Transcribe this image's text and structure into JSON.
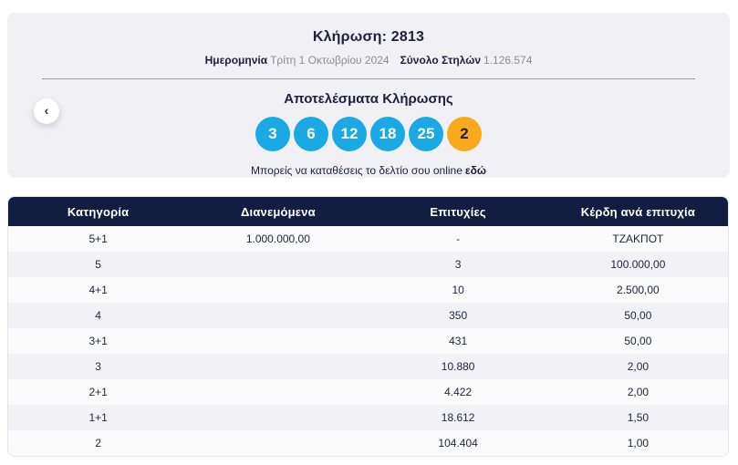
{
  "colors": {
    "ball_blue": "#1ba9e3",
    "ball_orange": "#f9a91c",
    "header_navy": "#131c41",
    "card_bg": "#f1f1f5",
    "row_alt": "#f2f2f6"
  },
  "draw_panel": {
    "title": "Κλήρωση: 2813",
    "date_label": "Ημερομηνία",
    "date_value": "Τρίτη 1 Οκτωβρίου 2024",
    "columns_label": "Σύνολο Στηλών",
    "columns_value": "1.126.574",
    "results_title": "Αποτελέσματα Κλήρωσης",
    "numbers": [
      "3",
      "6",
      "12",
      "18",
      "25"
    ],
    "joker_number": "2",
    "online_text": "Μπορείς να καταθέσεις το δελτίο σου online",
    "online_link_label": "εδώ",
    "prev_button_icon": "‹"
  },
  "prize_table": {
    "headers": [
      "Κατηγορία",
      "Διανεμόμενα",
      "Επιτυχίες",
      "Κέρδη ανά επιτυχία"
    ],
    "rows": [
      {
        "category": "5+1",
        "distributed": "1.000.000,00",
        "wins": "-",
        "prize": "ΤΖΑΚΠΟΤ"
      },
      {
        "category": "5",
        "distributed": "",
        "wins": "3",
        "prize": "100.000,00"
      },
      {
        "category": "4+1",
        "distributed": "",
        "wins": "10",
        "prize": "2.500,00"
      },
      {
        "category": "4",
        "distributed": "",
        "wins": "350",
        "prize": "50,00"
      },
      {
        "category": "3+1",
        "distributed": "",
        "wins": "431",
        "prize": "50,00"
      },
      {
        "category": "3",
        "distributed": "",
        "wins": "10.880",
        "prize": "2,00"
      },
      {
        "category": "2+1",
        "distributed": "",
        "wins": "4.422",
        "prize": "2,00"
      },
      {
        "category": "1+1",
        "distributed": "",
        "wins": "18.612",
        "prize": "1,50"
      },
      {
        "category": "2",
        "distributed": "",
        "wins": "104.404",
        "prize": "1,00"
      }
    ]
  }
}
